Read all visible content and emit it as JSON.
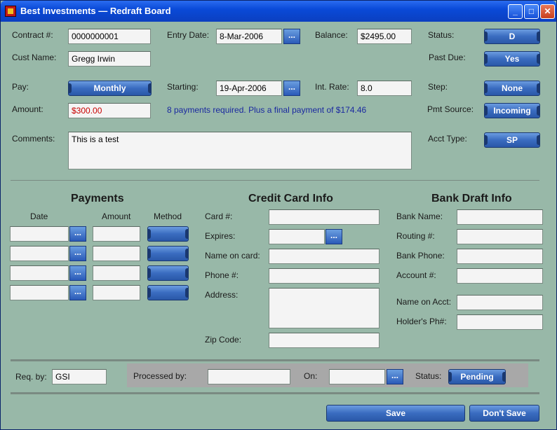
{
  "window": {
    "title": "Best Investments — Redraft Board",
    "minimize": "_",
    "maximize": "□",
    "close": "✕"
  },
  "top": {
    "contract_label": "Contract #:",
    "contract_value": "0000000001",
    "cust_label": "Cust Name:",
    "cust_value": "Gregg Irwin",
    "entry_label": "Entry Date:",
    "entry_value": "8-Mar-2006",
    "balance_label": "Balance:",
    "balance_value": "$2495.00",
    "status_label": "Status:",
    "status_value": "D",
    "pastdue_label": "Past Due:",
    "pastdue_value": "Yes",
    "pay_label": "Pay:",
    "pay_value": "Monthly",
    "starting_label": "Starting:",
    "starting_value": "19-Apr-2006",
    "rate_label": "Int. Rate:",
    "rate_value": "8.0",
    "step_label": "Step:",
    "step_value": "None",
    "amount_label": "Amount:",
    "amount_value": "$300.00",
    "payments_info": "8 payments required.  Plus a final payment of $174.46",
    "pmtsource_label": "Pmt Source:",
    "pmtsource_value": "Incoming",
    "comments_label": "Comments:",
    "comments_value": "This is a test",
    "accttype_label": "Acct Type:",
    "accttype_value": "SP",
    "dots": "..."
  },
  "payments": {
    "title": "Payments",
    "col_date": "Date",
    "col_amount": "Amount",
    "col_method": "Method"
  },
  "credit": {
    "title": "Credit Card Info",
    "card": "Card #:",
    "expires": "Expires:",
    "name": "Name on card:",
    "phone": "Phone #:",
    "address": "Address:",
    "zip": "Zip Code:"
  },
  "bank": {
    "title": "Bank Draft Info",
    "name": "Bank Name:",
    "routing": "Routing #:",
    "phone": "Bank Phone:",
    "account": "Account #:",
    "acct_name": "Name on Acct:",
    "holder_ph": "Holder's Ph#:"
  },
  "footer": {
    "reqby_label": "Req. by:",
    "reqby_value": "GSI",
    "processed_label": "Processed by:",
    "on_label": "On:",
    "status_label": "Status:",
    "status_value": "Pending"
  },
  "actions": {
    "save": "Save",
    "dont_save": "Don't Save"
  }
}
